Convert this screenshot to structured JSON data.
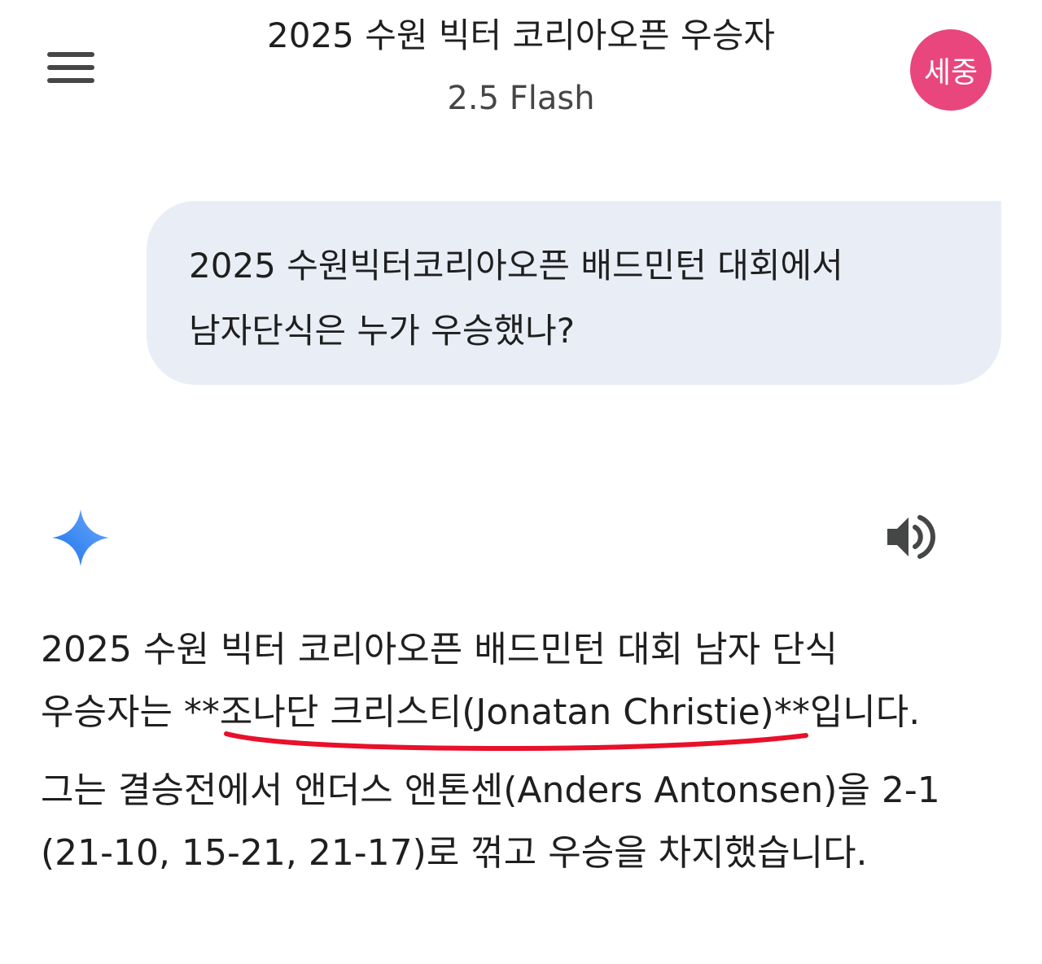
{
  "header": {
    "title": "2025 수원 빅터 코리아오픈 우승자",
    "model": "2.5 Flash",
    "avatar_initials": "세중",
    "avatar_color": "#e8467c"
  },
  "user_message": {
    "line1": "2025 수원빅터코리아오픈 배드민턴 대회에서",
    "line2": "남자단식은 누가 우승했나?"
  },
  "response": {
    "p1_line1": "2025 수원 빅터 코리아오픈 배드민턴 대회 남자 단식",
    "p1_line2_prefix": "우승자는 **",
    "p1_line2_name": "조나단 크리스티(Jonatan Christie)",
    "p1_line2_suffix": "**입니다.",
    "p2_line1": "그는 결승전에서 앤더스 앤톤센(Anders Antonsen)을 2-1",
    "p2_line2": "(21-10, 15-21, 21-17)로 꺾고 우승을 차지했습니다."
  },
  "icons": {
    "menu": "menu-icon",
    "spark": "gemini-spark-icon",
    "speaker": "speaker-icon"
  },
  "colors": {
    "bubble_bg": "#e9eef6",
    "underline_annotation": "#e8102a",
    "spark": "#4285f4"
  }
}
